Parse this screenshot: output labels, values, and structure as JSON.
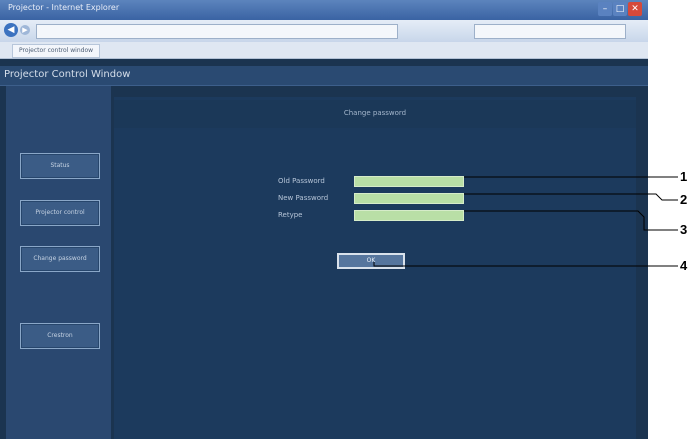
{
  "window": {
    "title": "Projector - Internet Explorer",
    "url": "",
    "tab_label": "Projector control window",
    "min_glyph": "–",
    "max_glyph": "□",
    "close_glyph": "✕"
  },
  "header": {
    "title": "Projector Control Window"
  },
  "sidebar": {
    "logo_text": "",
    "items": [
      {
        "label": "Status"
      },
      {
        "label": "Projector control"
      },
      {
        "label": "Change password"
      },
      {
        "label": "Crestron"
      }
    ]
  },
  "main": {
    "title": "Change password",
    "fields": [
      {
        "label": "Old Password",
        "value": ""
      },
      {
        "label": "New Password",
        "value": ""
      },
      {
        "label": "Retype",
        "value": ""
      }
    ],
    "ok_label": "OK"
  },
  "callouts": [
    "1",
    "2",
    "3",
    "4"
  ],
  "colors": {
    "page_bg": "#1b3450",
    "content_bg": "#1c3a5d",
    "input_bg": "#b9dfa6",
    "accent": "#3a63a3"
  }
}
